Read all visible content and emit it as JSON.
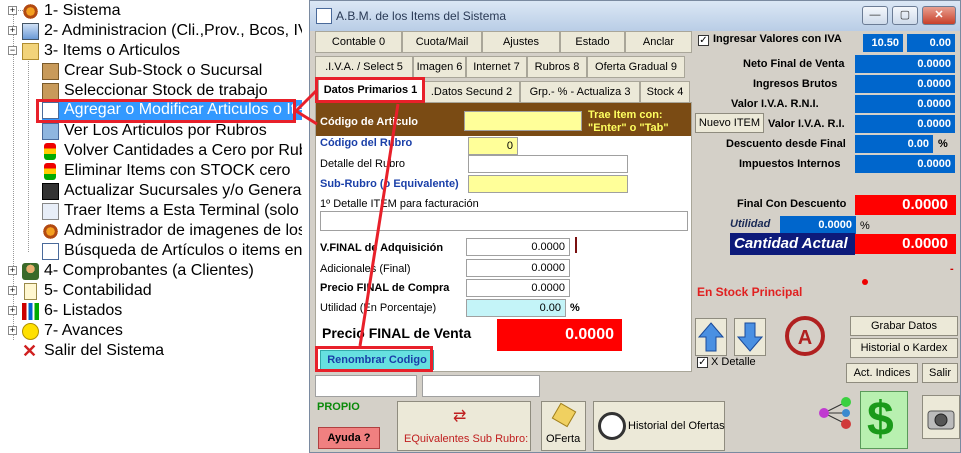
{
  "tree": {
    "items": [
      {
        "label": "1- Sistema",
        "icon": "gear-icon"
      },
      {
        "label": "2- Administracion (Cli.,Prov., Bcos, IV",
        "icon": "admin-icon"
      },
      {
        "label": "3- Items o Articulos",
        "icon": "folder-open-icon"
      },
      {
        "label": "Crear Sub-Stock o Sucursal",
        "icon": "box-icon"
      },
      {
        "label": "Seleccionar Stock de trabajo",
        "icon": "box-icon"
      },
      {
        "label": "Agregar o Modificar Articulos o Ite",
        "icon": "edit-item-icon"
      },
      {
        "label": "Ver Los Articulos por Rubros",
        "icon": "list-icon"
      },
      {
        "label": "Volver Cantidades a Cero por Rubro",
        "icon": "traffic-light-icon"
      },
      {
        "label": "Eliminar Items con STOCK cero",
        "icon": "traffic-light-icon"
      },
      {
        "label": "Actualizar Sucursales y/o  General",
        "icon": "sync-icon"
      },
      {
        "label": "Traer Items a Esta Terminal (solo e",
        "icon": "download-icon"
      },
      {
        "label": "Administrador de imagenes de los",
        "icon": "gear-icon"
      },
      {
        "label": "Búsqueda de Artículos o items  en",
        "icon": "search-item-icon"
      },
      {
        "label": "4- Comprobantes (a Clientes)",
        "icon": "person-icon"
      },
      {
        "label": "5- Contabilidad",
        "icon": "ledger-icon"
      },
      {
        "label": "6- Listados",
        "icon": "chart-icon"
      },
      {
        "label": "7- Avances",
        "icon": "smiley-icon"
      },
      {
        "label": "Salir del Sistema",
        "icon": "close-x-icon"
      }
    ]
  },
  "window": {
    "title": "A.B.M. de los Items del Sistema",
    "buttons": {
      "minimize": "—",
      "maximize": "▢",
      "close": "✕"
    }
  },
  "toolbar": [
    "Contable 0",
    "Cuota/Mail",
    "Ajustes",
    "Estado",
    "Anclar"
  ],
  "tabs_row1": [
    ".I.V.A. / Select 5",
    "Imagen 6",
    "Internet 7",
    "Rubros 8",
    "Oferta Gradual 9"
  ],
  "tabs_row2": [
    "Datos Primarios 1",
    ".Datos Secund 2",
    "Grp.- % - Actualiza 3",
    "Stock 4"
  ],
  "form": {
    "codigo_label": "Código de Articulo",
    "trae_item": "Trae Item con:",
    "enter_tab": "\"Enter\" o \"Tab\"",
    "codigo_rubro_label": "Código del Rubro",
    "codigo_rubro_value": "0",
    "detalle_rubro_label": "Detalle del Rubro",
    "subrubro_label": "Sub-Rubro (o Equivalente)",
    "detalle_item_label": "1º Detalle ITEM para facturación",
    "vfinal_label": "V.FINAL de Adquisición",
    "vfinal_value": "0.0000",
    "adicionales_label": "Adicionales (Final)",
    "adicionales_value": "0.0000",
    "precio_compra_label": "Precio FINAL de Compra",
    "precio_compra_value": "0.0000",
    "utilidad_label": "Utilidad (En Porcentaje)",
    "utilidad_value": "0.00",
    "percent": "%",
    "precio_venta_label": "Precio FINAL de  Venta",
    "precio_venta_value": "0.0000",
    "renombrar": "Renombrar Codigo"
  },
  "right": {
    "iva_check_label": "Ingresar Valores con IVA",
    "iva_rate": "10.50",
    "iva_val": "0.00",
    "neto_label": "Neto Final de Venta",
    "neto": "0.0000",
    "ingresos_label": "Ingresos Brutos",
    "ingresos": "0.0000",
    "rni_label": "Valor I.V.A. R.N.I.",
    "rni": "0.0000",
    "ri_label": "Valor I.V.A. R.I.",
    "ri": "0.0000",
    "nuevo_item": "Nuevo ITEM",
    "desc_label": "Descuento desde Final",
    "desc": "0.00",
    "desc_pct": "%",
    "imp_label": "Impuestos Internos",
    "imp": "0.0000",
    "final_desc_label": "Final Con Descuento",
    "final_desc": "0.0000",
    "utilidad_label": "Utilidad",
    "utilidad": "0.0000",
    "utilidad_pct": "%",
    "cantidad_label": "Cantidad Actual",
    "cantidad": "0.0000",
    "dash": "-",
    "stock_principal": "En Stock Principal",
    "grabar": "Grabar Datos",
    "historial": "Historial o Kardex",
    "x_detalle": "X Detalle",
    "act_indices": "Act. Indices",
    "salir": "Salir"
  },
  "bottom": {
    "propio": "PROPIO",
    "ayuda": "Ayuda ?",
    "equivalentes": "EQuivalentes Sub Rubro:",
    "oferta": "OFerta",
    "historial_ofertas": "Historial del Ofertas"
  },
  "colors": {
    "accent_red": "#ff0000",
    "field_yellow": "#ffff99",
    "header_brown": "#7a4b14",
    "blue_field": "#0066cc",
    "highlight": "#e8202a"
  }
}
